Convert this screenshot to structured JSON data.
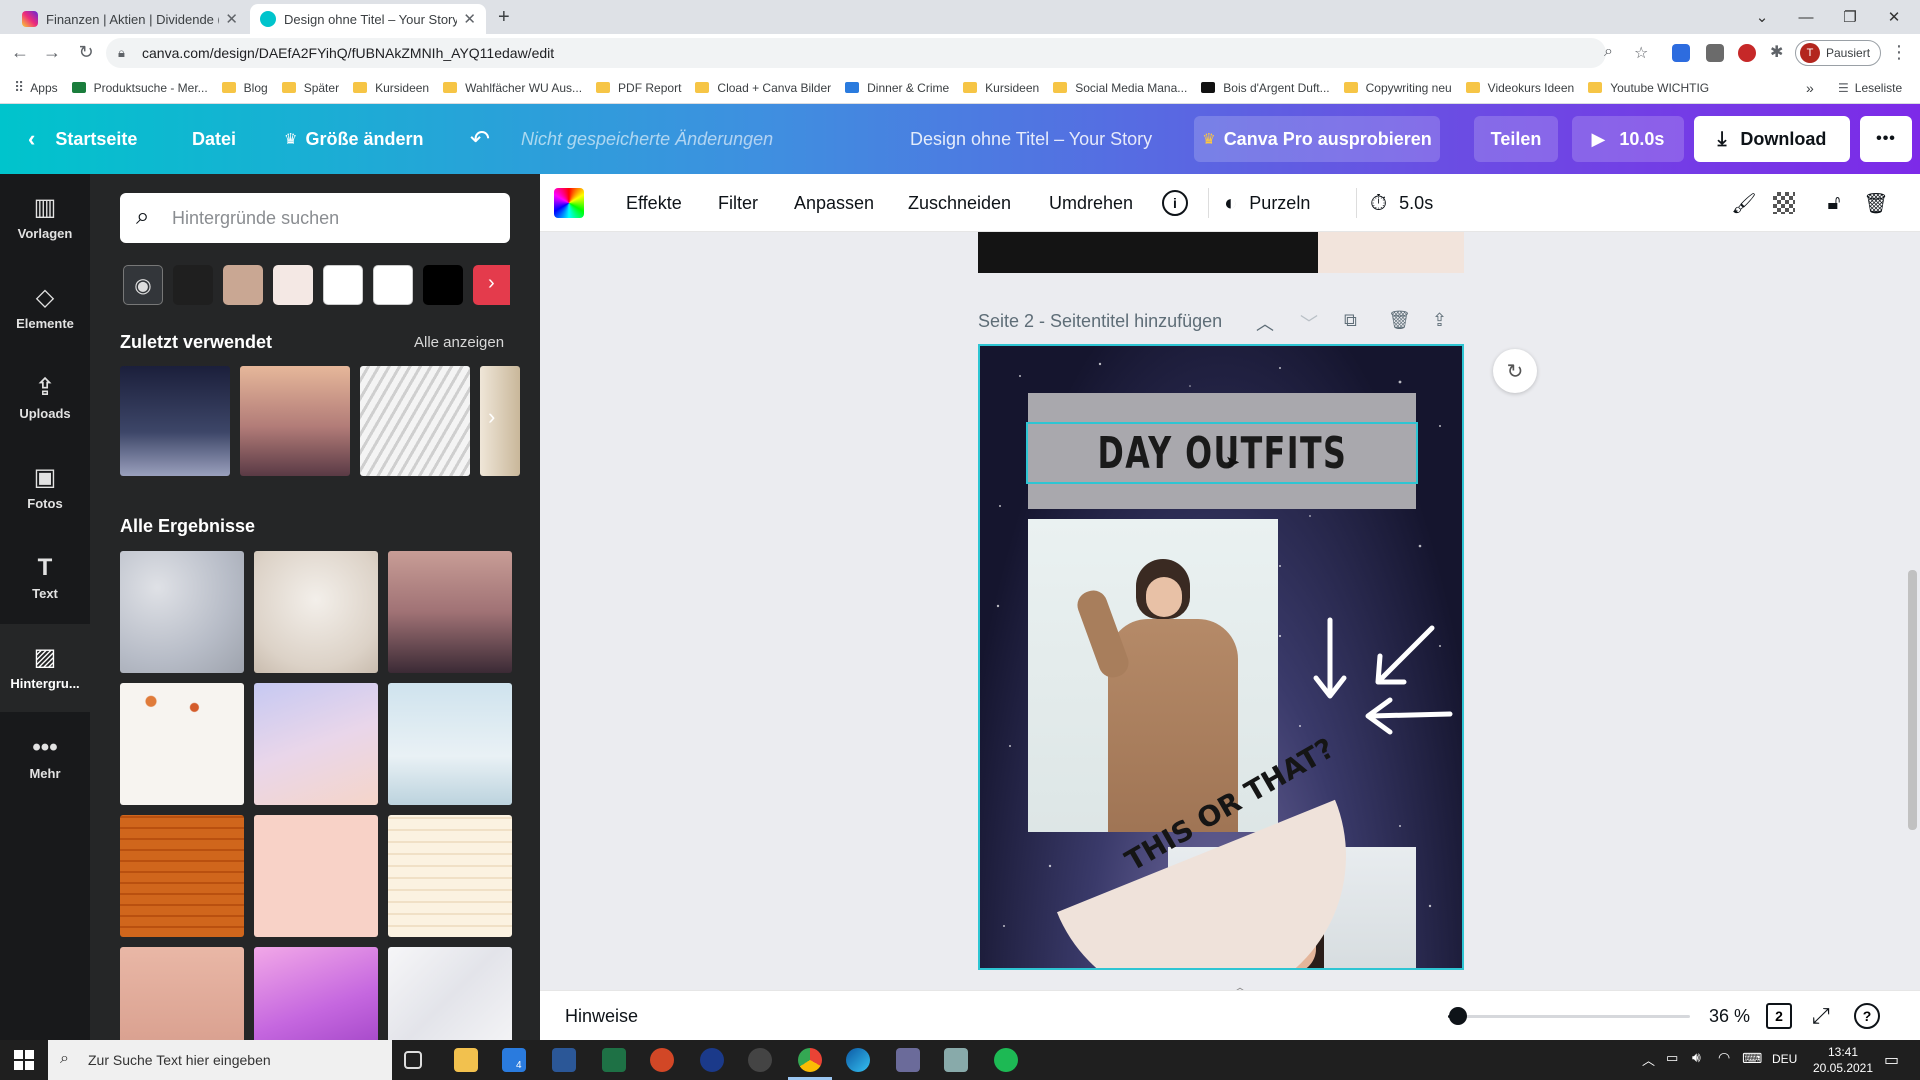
{
  "browser": {
    "tabs": [
      {
        "title": "Finanzen | Aktien | Dividende (@",
        "active": false
      },
      {
        "title": "Design ohne Titel – Your Story",
        "active": true
      }
    ],
    "new_tab": "+",
    "url": "canva.com/design/DAEfA2FYihQ/fUBNAkZMNIh_AYQ11edaw/edit",
    "profile": {
      "initial": "T",
      "status": "Pausiert"
    },
    "bookmarks": [
      "Apps",
      "Produktsuche - Mer...",
      "Blog",
      "Später",
      "Kursideen",
      "Wahlfächer WU Aus...",
      "PDF Report",
      "Cload + Canva Bilder",
      "Dinner & Crime",
      "Kursideen",
      "Social Media Mana...",
      "Bois d'Argent Duft...",
      "Copywriting neu",
      "Videokurs Ideen",
      "Youtube WICHTIG"
    ],
    "bookmarks_more": "»",
    "reading_list": "Leseliste"
  },
  "header": {
    "home": "Startseite",
    "file": "Datei",
    "resize": "Größe ändern",
    "save_status": "Nicht gespeicherte Änderungen",
    "doc_title": "Design ohne Titel – Your Story",
    "pro": "Canva Pro ausprobieren",
    "share": "Teilen",
    "play_duration": "10.0s",
    "download": "Download",
    "more": "•••"
  },
  "left_nav": [
    {
      "label": "Vorlagen",
      "icon": "templates-icon"
    },
    {
      "label": "Elemente",
      "icon": "elements-icon"
    },
    {
      "label": "Uploads",
      "icon": "upload-icon"
    },
    {
      "label": "Fotos",
      "icon": "photos-icon"
    },
    {
      "label": "Text",
      "icon": "text-icon"
    },
    {
      "label": "Hintergru...",
      "icon": "background-icon"
    },
    {
      "label": "Mehr",
      "icon": "more-icon"
    }
  ],
  "panel": {
    "search_placeholder": "Hintergründe suchen",
    "swatches": [
      "#1f1f1f",
      "#c9a793",
      "#f4e8e4",
      "#ffffff",
      "#ffffff",
      "#000000",
      "#e43b4c"
    ],
    "recent_title": "Zuletzt verwendet",
    "see_all": "Alle anzeigen",
    "results_title": "Alle Ergebnisse"
  },
  "toolbar": {
    "effects": "Effekte",
    "filter": "Filter",
    "adjust": "Anpassen",
    "crop": "Zuschneiden",
    "flip": "Umdrehen",
    "animate": "Purzeln",
    "duration": "5.0s"
  },
  "canvas": {
    "page_label": "Seite 2 - Seitentitel hinzufügen",
    "heading": "DAY OUTFITS",
    "curved_text": "THIS OR THAT?"
  },
  "footer": {
    "notes": "Hinweise",
    "zoom": "36 %",
    "page_count": "2",
    "zoom_fraction": 0.04
  },
  "taskbar": {
    "search_placeholder": "Zur Suche Text hier eingeben",
    "mail_badge": "4",
    "language": "DEU",
    "time": "13:41",
    "date": "20.05.2021"
  },
  "colors": {
    "header_start": "#00c4cc",
    "header_end": "#7d2ae8",
    "panel_bg": "#252627",
    "nav_bg": "#18191b",
    "selection": "#2ec5d3"
  }
}
